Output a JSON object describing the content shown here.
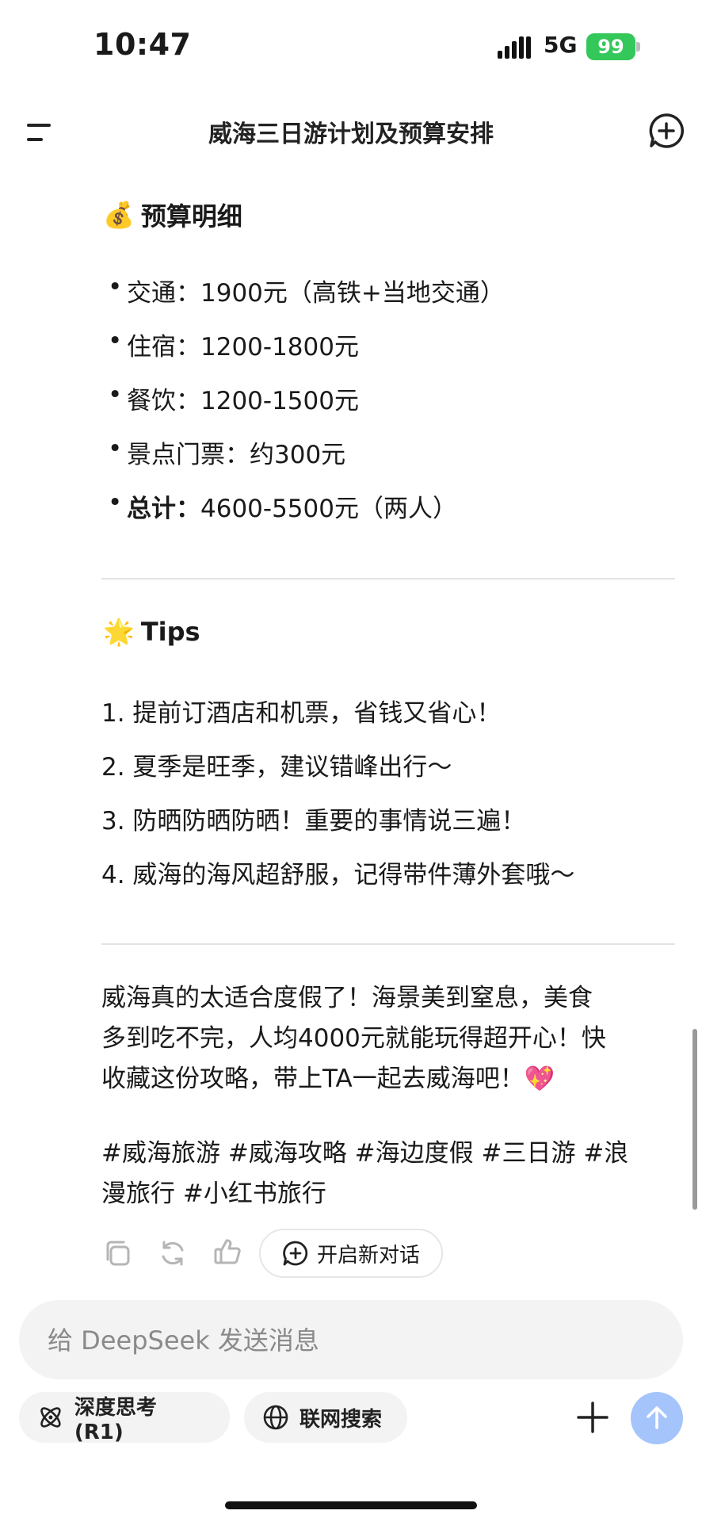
{
  "status_bar": {
    "time": "10:47",
    "network": "5G",
    "battery": "99"
  },
  "header": {
    "title": "威海三日游计划及预算安排"
  },
  "budget": {
    "emoji": "💰",
    "title": "预算明细",
    "items": [
      {
        "label": "交通：",
        "value": "1900元（高铁+当地交通）"
      },
      {
        "label": "住宿：",
        "value": "1200-1800元"
      },
      {
        "label": "餐饮：",
        "value": "1200-1500元"
      },
      {
        "label": "景点门票：",
        "value": "约300元"
      },
      {
        "label": "总计：",
        "value": "4600-5500元（两人）"
      }
    ]
  },
  "tips": {
    "emoji": "🌟",
    "title": "Tips",
    "items": [
      "1. 提前订酒店和机票，省钱又省心！",
      "2. 夏季是旺季，建议错峰出行～",
      "3. 防晒防晒防晒！重要的事情说三遍！",
      "4. 威海的海风超舒服，记得带件薄外套哦～"
    ]
  },
  "closing": {
    "lines": [
      "威海真的太适合度假了！海景美到窒息，美食",
      "多到吃不完，人均4000元就能玩得超开心！快",
      "收藏这份攻略，带上TA一起去威海吧！💖"
    ],
    "hashtags_lines": [
      "#威海旅游 #威海攻略 #海边度假 #三日游 #浪",
      "漫旅行 #小红书旅行"
    ]
  },
  "actions": {
    "new_dialog_label": "开启新对话"
  },
  "composer": {
    "placeholder": "给 DeepSeek 发送消息",
    "deep_think_label": "深度思考 (R1)",
    "web_search_label": "联网搜索"
  },
  "colors": {
    "accent": "#a4c4fb",
    "battery": "#34c759",
    "chip_bg": "#f3f3f3"
  }
}
